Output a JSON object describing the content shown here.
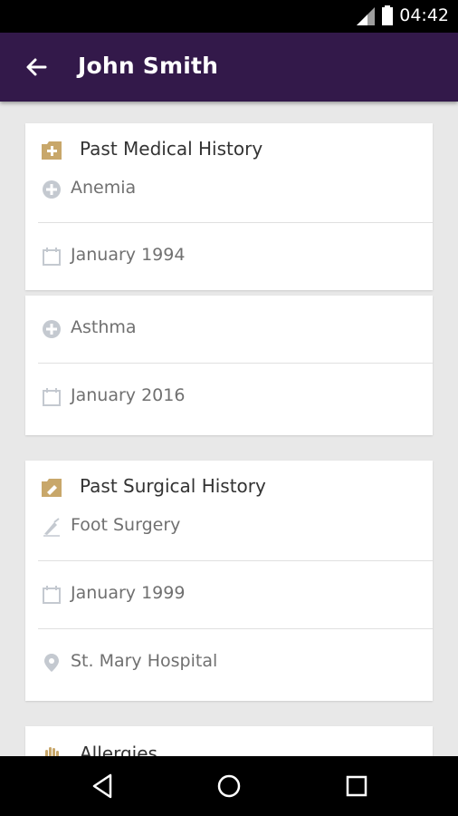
{
  "status_bar": {
    "time": "04:42"
  },
  "app_bar": {
    "title": "John Smith"
  },
  "medical_history": {
    "title": "Past Medical History",
    "entries": [
      {
        "condition": "Anemia",
        "date": "January 1994"
      },
      {
        "condition": "Asthma",
        "date": "January 2016"
      }
    ]
  },
  "surgical_history": {
    "title": "Past Surgical History",
    "procedure": "Foot Surgery",
    "date": "January 1999",
    "location": "St. Mary Hospital"
  },
  "allergies": {
    "title": "Allergies"
  },
  "colors": {
    "app_bar": "#33194a",
    "section_icon": "#c8a76a",
    "row_icon": "#c4c9d0"
  },
  "icons": {
    "back": "arrow-left-icon",
    "medical": "medical-folder-icon",
    "surgical": "surgical-folder-icon",
    "condition": "plus-circle-icon",
    "date": "calendar-icon",
    "procedure": "scalpel-icon",
    "location": "location-pin-icon",
    "allergies": "hand-icon"
  }
}
